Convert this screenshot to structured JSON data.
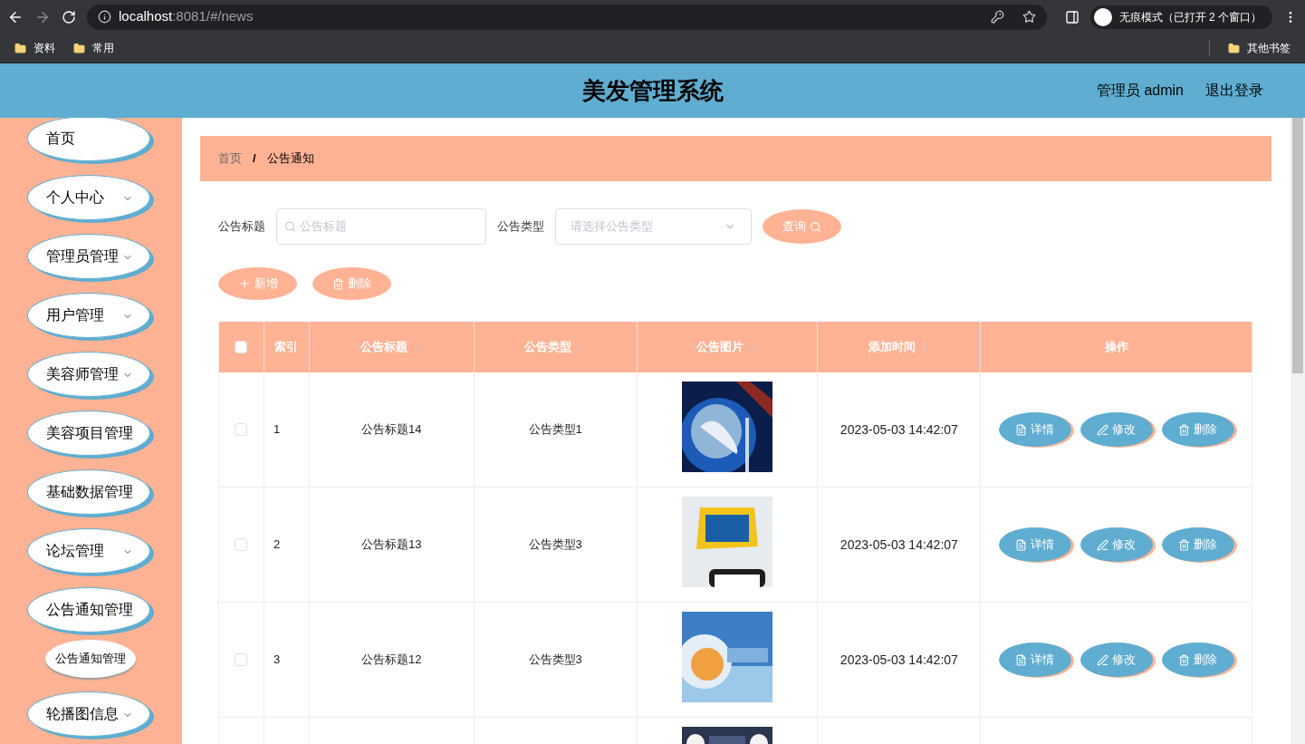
{
  "browser": {
    "url_host": "localhost",
    "url_rest": ":8081/#/news",
    "profile": "无痕模式（已打开 2 个窗口）",
    "bookmarks": [
      "资料",
      "常用"
    ],
    "other_bookmarks": "其他书签"
  },
  "header": {
    "title": "美发管理系统",
    "user": "管理员 admin",
    "logout": "退出登录"
  },
  "sidebar": {
    "items": [
      {
        "label": "首页",
        "kind": "link"
      },
      {
        "label": "个人中心",
        "kind": "menu",
        "expanded": false
      },
      {
        "label": "管理员管理",
        "kind": "menu",
        "expanded": false
      },
      {
        "label": "用户管理",
        "kind": "menu",
        "expanded": false
      },
      {
        "label": "美容师管理",
        "kind": "menu",
        "expanded": false
      },
      {
        "label": "美容项目管理",
        "kind": "menu",
        "expanded": false
      },
      {
        "label": "基础数据管理",
        "kind": "menu",
        "expanded": false
      },
      {
        "label": "论坛管理",
        "kind": "menu",
        "expanded": false
      },
      {
        "label": "公告通知管理",
        "kind": "menu",
        "expanded": true,
        "children": [
          {
            "label": "公告通知管理"
          }
        ]
      },
      {
        "label": "轮播图信息",
        "kind": "menu",
        "expanded": false
      }
    ]
  },
  "breadcrumb": {
    "items": [
      "首页",
      "公告通知"
    ],
    "separator": "/"
  },
  "filters": [
    {
      "label": "公告标题",
      "kind": "text",
      "placeholder": "公告标题"
    },
    {
      "label": "公告类型",
      "kind": "select",
      "placeholder": "请选择公告类型"
    }
  ],
  "search_button": "查询",
  "actions": [
    {
      "label": "新增",
      "kind": "add"
    },
    {
      "label": "删除",
      "kind": "delete"
    }
  ],
  "table": {
    "select_all_checked": false,
    "columns": [
      {
        "label": "索引",
        "sortable": false
      },
      {
        "label": "公告标题",
        "sortable": true
      },
      {
        "label": "公告类型",
        "sortable": true
      },
      {
        "label": "公告图片",
        "sortable": true
      },
      {
        "label": "添加时间",
        "sortable": true
      },
      {
        "label": "操作",
        "sortable": false
      }
    ],
    "rows": [
      {
        "checked": false,
        "index": "1",
        "title": "公告标题14",
        "type": "公告类型1",
        "image": {
          "kind": "picture"
        },
        "time": "2023-05-03 14:42:07",
        "buttons": [
          "详情",
          "修改",
          "删除"
        ]
      },
      {
        "checked": false,
        "index": "2",
        "title": "公告标题13",
        "type": "公告类型3",
        "image": {
          "kind": "picture"
        },
        "time": "2023-05-03 14:42:07",
        "buttons": [
          "详情",
          "修改",
          "删除"
        ]
      },
      {
        "checked": false,
        "index": "3",
        "title": "公告标题12",
        "type": "公告类型3",
        "image": {
          "kind": "picture"
        },
        "time": "2023-05-03 14:42:07",
        "buttons": [
          "详情",
          "修改",
          "删除"
        ]
      },
      {
        "image": {
          "kind": "picture"
        }
      }
    ]
  }
}
